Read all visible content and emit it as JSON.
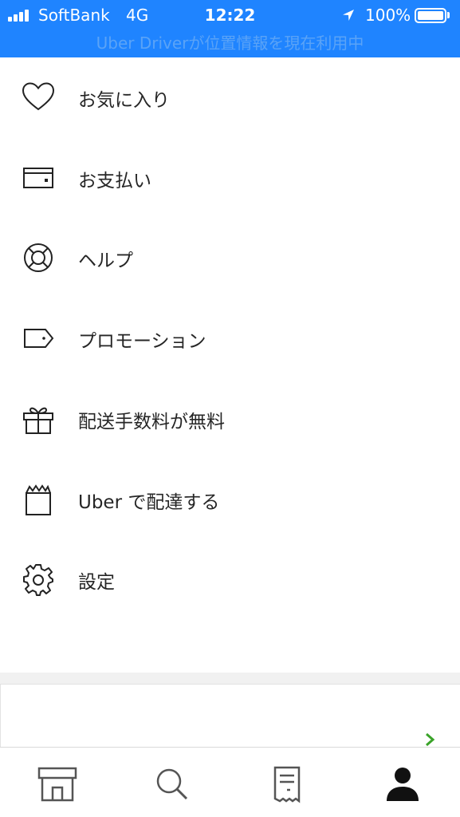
{
  "status_bar": {
    "carrier": "SoftBank",
    "network": "4G",
    "time": "12:22",
    "battery_percent": "100%",
    "location_banner": "Uber Driverが位置情報を現在利用中",
    "background_color": "#1f84ff"
  },
  "menu": {
    "items": [
      {
        "label": "お気に入り",
        "icon": "heart-icon"
      },
      {
        "label": "お支払い",
        "icon": "wallet-icon"
      },
      {
        "label": "ヘルプ",
        "icon": "lifebuoy-icon"
      },
      {
        "label": "プロモーション",
        "icon": "tag-icon"
      },
      {
        "label": "配送手数料が無料",
        "icon": "gift-icon"
      },
      {
        "label": "Uber で配達する",
        "icon": "shopping-bag-icon"
      },
      {
        "label": "設定",
        "icon": "gear-icon"
      }
    ]
  },
  "promo_card": {
    "chevron_icon": "chevron-right-icon",
    "chevron_color": "#3aa329"
  },
  "tab_bar": {
    "tabs": [
      {
        "name": "home",
        "icon": "store-icon",
        "selected": false
      },
      {
        "name": "search",
        "icon": "search-icon",
        "selected": false
      },
      {
        "name": "orders",
        "icon": "receipt-icon",
        "selected": false
      },
      {
        "name": "account",
        "icon": "person-icon",
        "selected": true
      }
    ]
  }
}
